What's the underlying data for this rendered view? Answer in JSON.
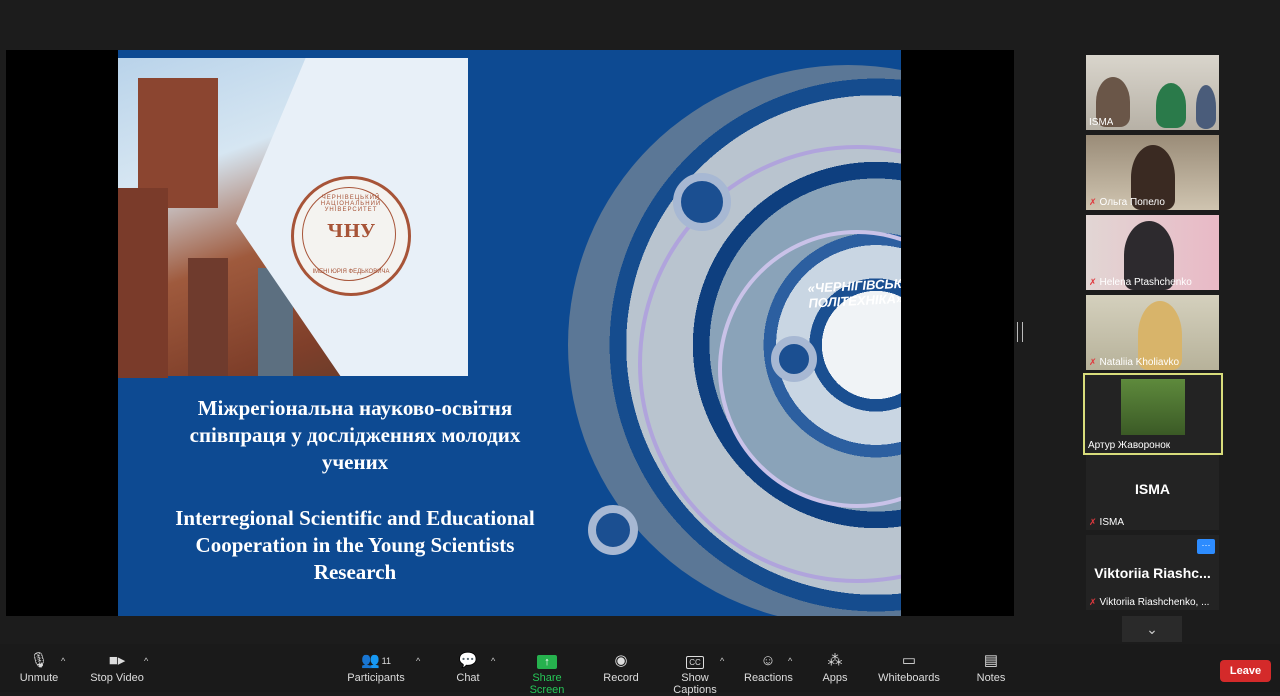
{
  "slide": {
    "seal_mark": "ЧНУ",
    "seal_ring": "ЧЕРНІВЕЦЬКИЙ НАЦІОНАЛЬНИЙ УНІВЕРСИТЕТ",
    "seal_bottom": "ІМЕНІ ЮРІЯ ФЕДЬКОВИЧА",
    "sign": "«ЧЕРНІГІВСЬКА ПОЛІТЕХНІКА»",
    "title_uk": "Міжрегіональна науково-освітня співпраця у дослідженнях молодих учених",
    "title_en": "Interregional Scientific and Educational Cooperation in the Young Scientists Research"
  },
  "participants": [
    {
      "name": "ISMA",
      "muted": false
    },
    {
      "name": "Ольга Попело",
      "muted": true
    },
    {
      "name": "Helena Ptashchenko",
      "muted": true
    },
    {
      "name": "Nataliia Kholiavko",
      "muted": true
    },
    {
      "name": "Артур Жаворонок",
      "muted": false
    },
    {
      "name": "ISMA",
      "muted": true,
      "label": "ISMA"
    },
    {
      "name": "Viktoriia Riashchenko, ...",
      "muted": true,
      "label": "Viktoriia  Riashc..."
    }
  ],
  "more_icon": "more-options-icon",
  "scroll_icon": "chevron-down-icon",
  "toolbar": {
    "unmute": "Unmute",
    "stop_video": "Stop Video",
    "participants": "Participants",
    "participants_count": "11",
    "chat": "Chat",
    "share_screen": "Share Screen",
    "record": "Record",
    "show_captions": "Show Captions",
    "cc_label": "CC",
    "reactions": "Reactions",
    "apps": "Apps",
    "whiteboards": "Whiteboards",
    "notes": "Notes",
    "leave": "Leave"
  },
  "colors": {
    "accent_green": "#26b24e",
    "leave_red": "#d42a2a",
    "active_speaker": "#d8dc7b",
    "slide_blue": "#0d4a92"
  }
}
